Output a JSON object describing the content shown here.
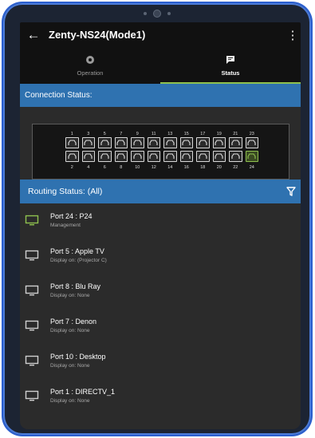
{
  "app": {
    "title": "Zenty-NS24(Mode1)"
  },
  "tabs": [
    {
      "label": "Operation",
      "active": false
    },
    {
      "label": "Status",
      "active": true
    }
  ],
  "connection": {
    "header": "Connection Status:",
    "top_ports": [
      "1",
      "3",
      "5",
      "7",
      "9",
      "11",
      "13",
      "15",
      "17",
      "19",
      "21",
      "23"
    ],
    "bottom_ports": [
      "2",
      "4",
      "6",
      "8",
      "10",
      "12",
      "14",
      "16",
      "18",
      "20",
      "22",
      "24"
    ],
    "active_ports": [
      "24"
    ]
  },
  "routing": {
    "header": "Routing Status: (All)",
    "items": [
      {
        "title": "Port 24 : P24",
        "subtitle": "Management",
        "icon": "monitor-icon",
        "active": true
      },
      {
        "title": "Port 5 : Apple TV",
        "subtitle": "Display on: (Projector C)",
        "icon": "monitor-icon",
        "active": false
      },
      {
        "title": "Port 8 : Blu Ray",
        "subtitle": "Display on: None",
        "icon": "monitor-icon",
        "active": false
      },
      {
        "title": "Port 7 : Denon",
        "subtitle": "Display on: None",
        "icon": "monitor-icon",
        "active": false
      },
      {
        "title": "Port 10 : Desktop",
        "subtitle": "Display on: None",
        "icon": "monitor-icon",
        "active": false
      },
      {
        "title": "Port 1 : DIRECTV_1",
        "subtitle": "Display on: None",
        "icon": "monitor-icon",
        "active": false
      }
    ]
  },
  "colors": {
    "accent_blue": "#2f72b0",
    "active_green": "#8fc14e",
    "background": "#2b2b2b",
    "appbar": "#111111"
  }
}
